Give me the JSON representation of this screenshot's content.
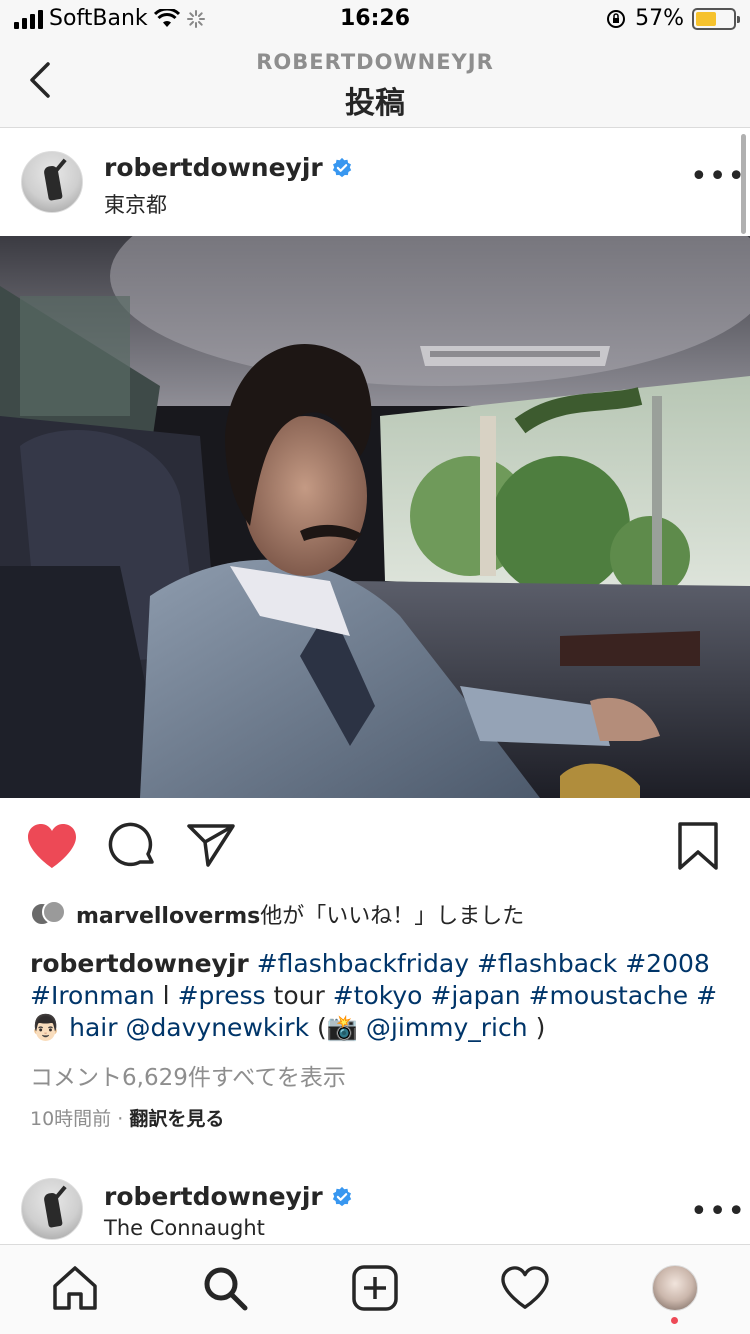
{
  "status_bar": {
    "carrier": "SoftBank",
    "time": "16:26",
    "battery": "57%"
  },
  "nav": {
    "subtitle": "ROBERTDOWNEYJR",
    "title": "投稿"
  },
  "post": {
    "username": "robertdowneyjr",
    "location": "東京都",
    "likes": {
      "user": "marvelloverms",
      "suffix": "他が「いいね！」しました"
    },
    "caption": {
      "user": "robertdowneyjr",
      "t1": "#flashbackfriday",
      "t2": "#flashback",
      "t3": "#2008",
      "t4": "#Ironman",
      "s1": "l",
      "t5": "#press",
      "s2": "tour",
      "t6": "#tokyo",
      "t7": "#japan",
      "t8": "#moustache",
      "t9": "#",
      "emoji1": "👨🏻",
      "t10": "hair",
      "m1": "@davynewkirk",
      "s3": "(",
      "emoji2": "📸",
      "m2": "@jimmy_rich",
      "s4": ")"
    },
    "comments_link": "コメント6,629件すべてを表示",
    "time_ago": "10時間前",
    "separator": "·",
    "translate": "翻訳を見る"
  },
  "next_post": {
    "username": "robertdowneyjr",
    "location": "The Connaught"
  },
  "colors": {
    "like_red": "#ed4956",
    "verified_blue": "#3897f0",
    "hashtag": "#003569",
    "battery": "#f6c22d"
  }
}
